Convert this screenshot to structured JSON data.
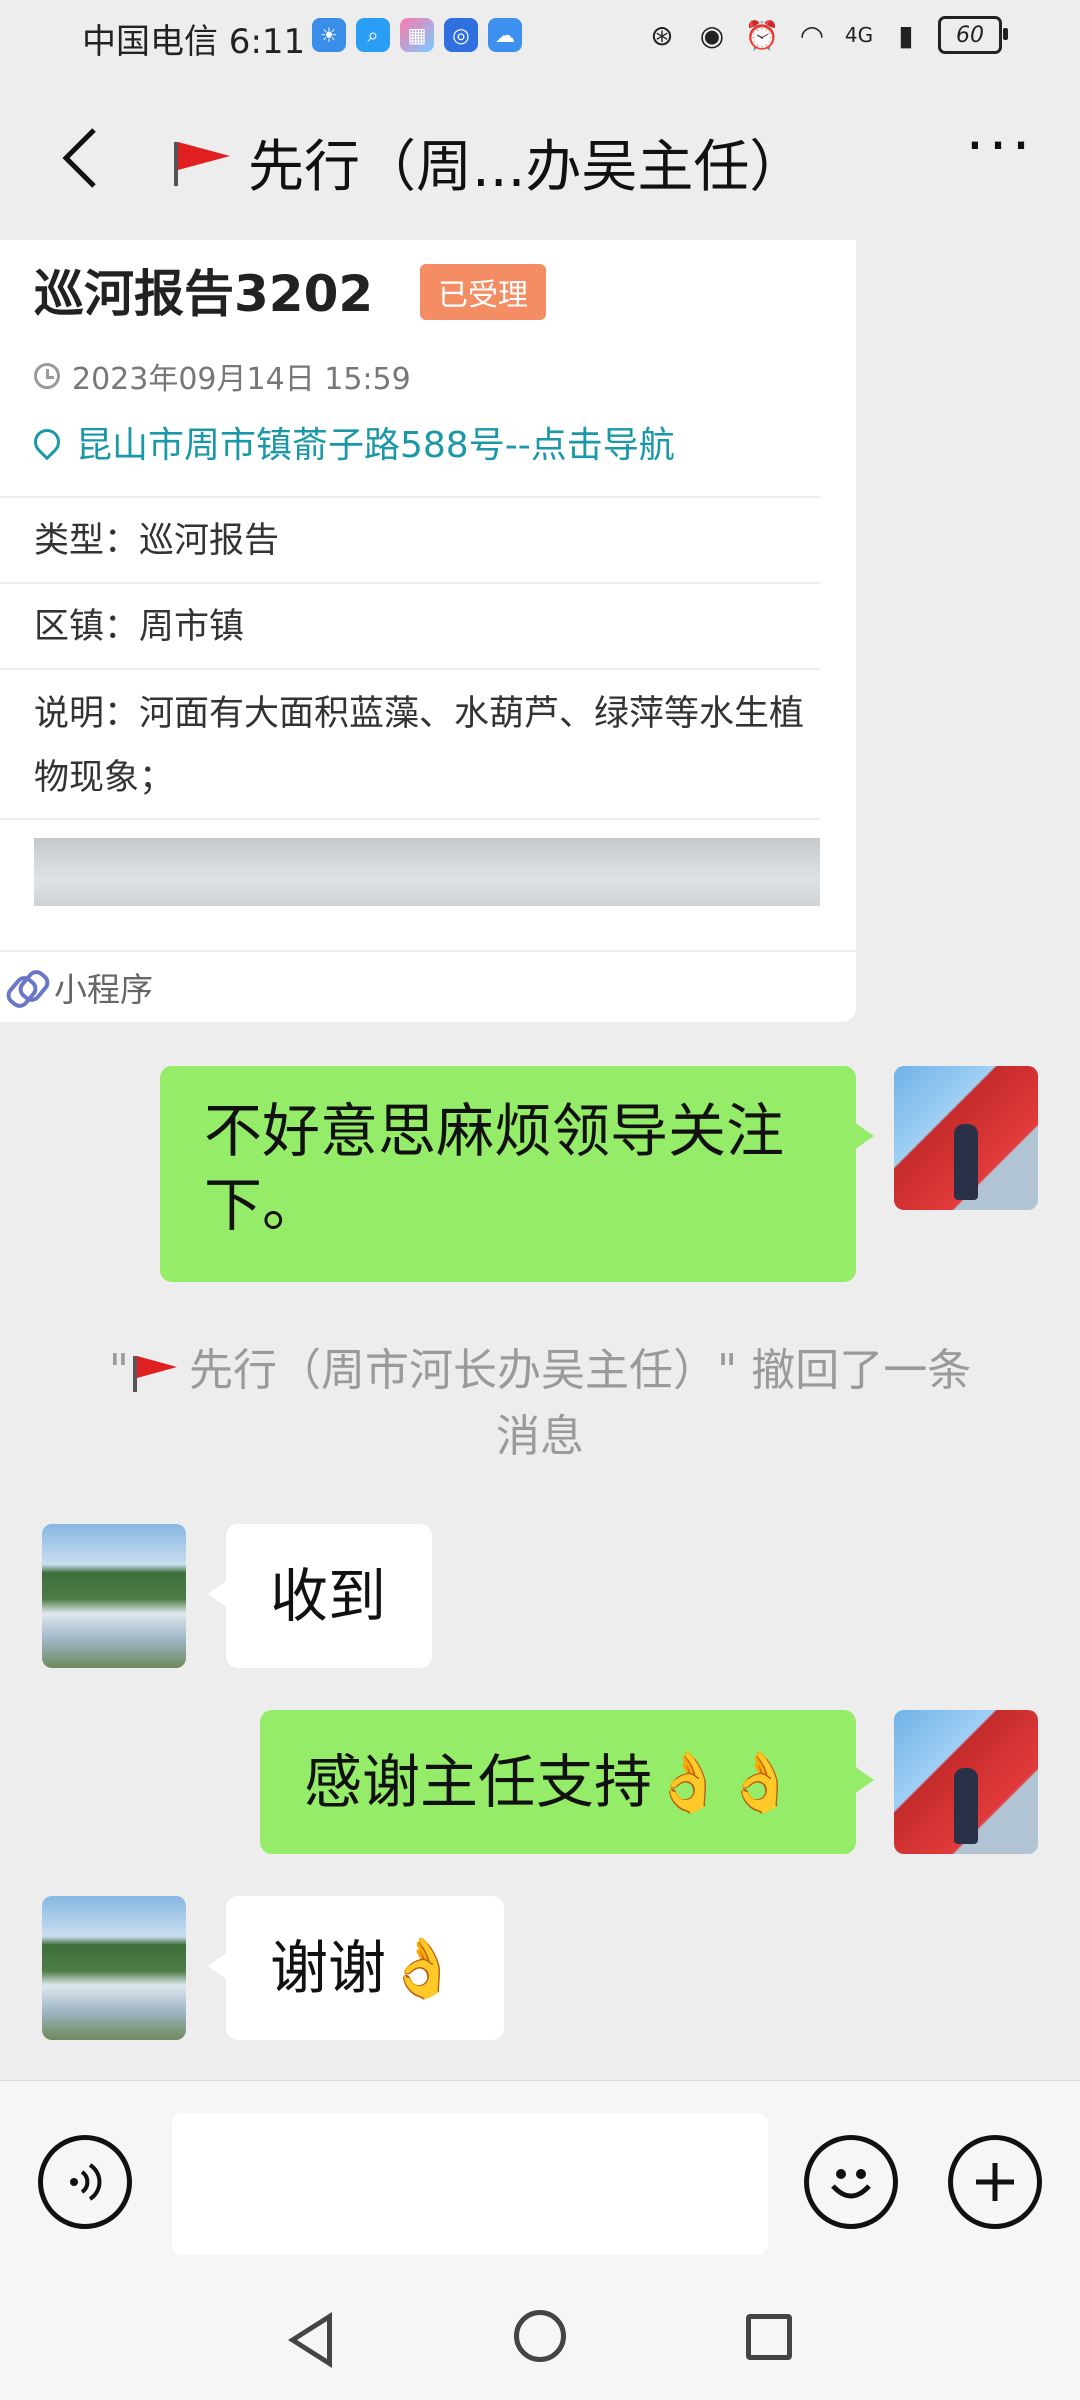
{
  "statusbar": {
    "carrier_time": "中国电信 6:11",
    "network": "4G",
    "battery": "60"
  },
  "header": {
    "title": "先行（周...办吴主任）"
  },
  "card": {
    "title": "巡河报告3202",
    "badge": "已受理",
    "time": "2023年09月14日 15:59",
    "location": "昆山市周市镇萮子路588号--点击导航",
    "type_label": "类型：",
    "type_value": "巡河报告",
    "district_label": "区镇：",
    "district_value": "周市镇",
    "desc_label": "说明：",
    "desc_value": "河面有大面积蓝藻、水葫芦、绿萍等水生植物现象；",
    "footer": "小程序"
  },
  "messages": [
    {
      "side": "right",
      "text": "不好意思麻烦领导关注下。"
    },
    {
      "side": "left",
      "text": "收到"
    },
    {
      "side": "right",
      "text": "感谢主任支持👌👌"
    },
    {
      "side": "left",
      "text": "谢谢👌"
    }
  ],
  "system_notice": {
    "prefix": "\"",
    "name": "先行（周市河长办吴主任）",
    "suffix": "\" 撤回了一条消息"
  },
  "input": {
    "placeholder": ""
  },
  "icons": {
    "back": "chevron-left-icon",
    "more": "more-dots-icon",
    "voice": "voice-icon",
    "emoji": "emoji-icon",
    "plus": "plus-icon"
  }
}
